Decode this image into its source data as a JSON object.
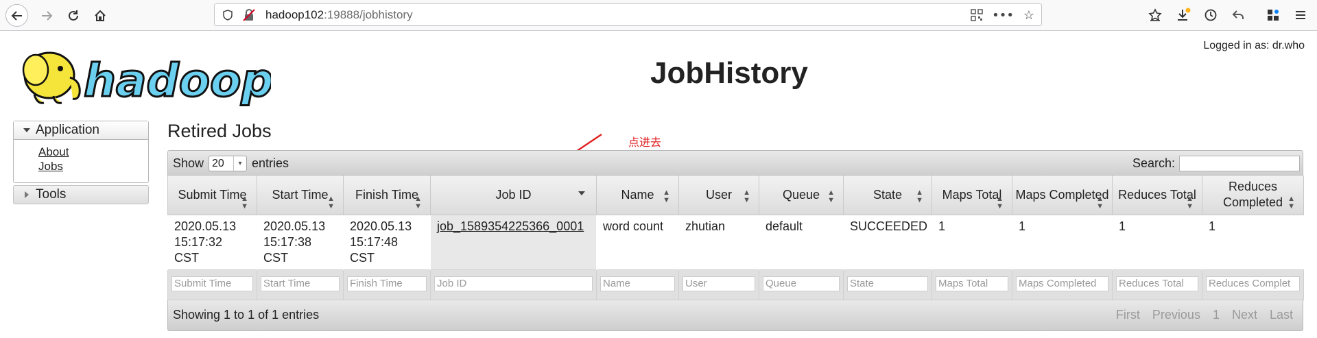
{
  "browser": {
    "url_host": "hadoop102",
    "url_rest": ":19888/jobhistory"
  },
  "header": {
    "logged_in": "Logged in as: dr.who",
    "title": "JobHistory",
    "logo_text": "hadoop"
  },
  "nav": {
    "application_label": "Application",
    "links": [
      "About",
      "Jobs"
    ],
    "tools_label": "Tools"
  },
  "main": {
    "heading": "Retired Jobs",
    "annotation": "点进去",
    "show_label": "Show",
    "entries_label": "entries",
    "page_size": "20",
    "search_label": "Search:",
    "columns": [
      "Submit Time",
      "Start Time",
      "Finish Time",
      "Job ID",
      "Name",
      "User",
      "Queue",
      "State",
      "Maps Total",
      "Maps Completed",
      "Reduces Total",
      "Reduces Completed"
    ],
    "rows": [
      {
        "submit_time": "2020.05.13 15:17:32 CST",
        "start_time": "2020.05.13 15:17:38 CST",
        "finish_time": "2020.05.13 15:17:48 CST",
        "job_id": "job_1589354225366_0001",
        "name": "word count",
        "user": "zhutian",
        "queue": "default",
        "state": "SUCCEEDED",
        "maps_total": "1",
        "maps_completed": "1",
        "reduces_total": "1",
        "reduces_completed": "1"
      }
    ],
    "filter_placeholders": [
      "Submit Time",
      "Start Time",
      "Finish Time",
      "Job ID",
      "Name",
      "User",
      "Queue",
      "State",
      "Maps Total",
      "Maps Completed",
      "Reduces Total",
      "Reduces Complet"
    ],
    "info": "Showing 1 to 1 of 1 entries",
    "pagination": [
      "First",
      "Previous",
      "1",
      "Next",
      "Last"
    ]
  }
}
